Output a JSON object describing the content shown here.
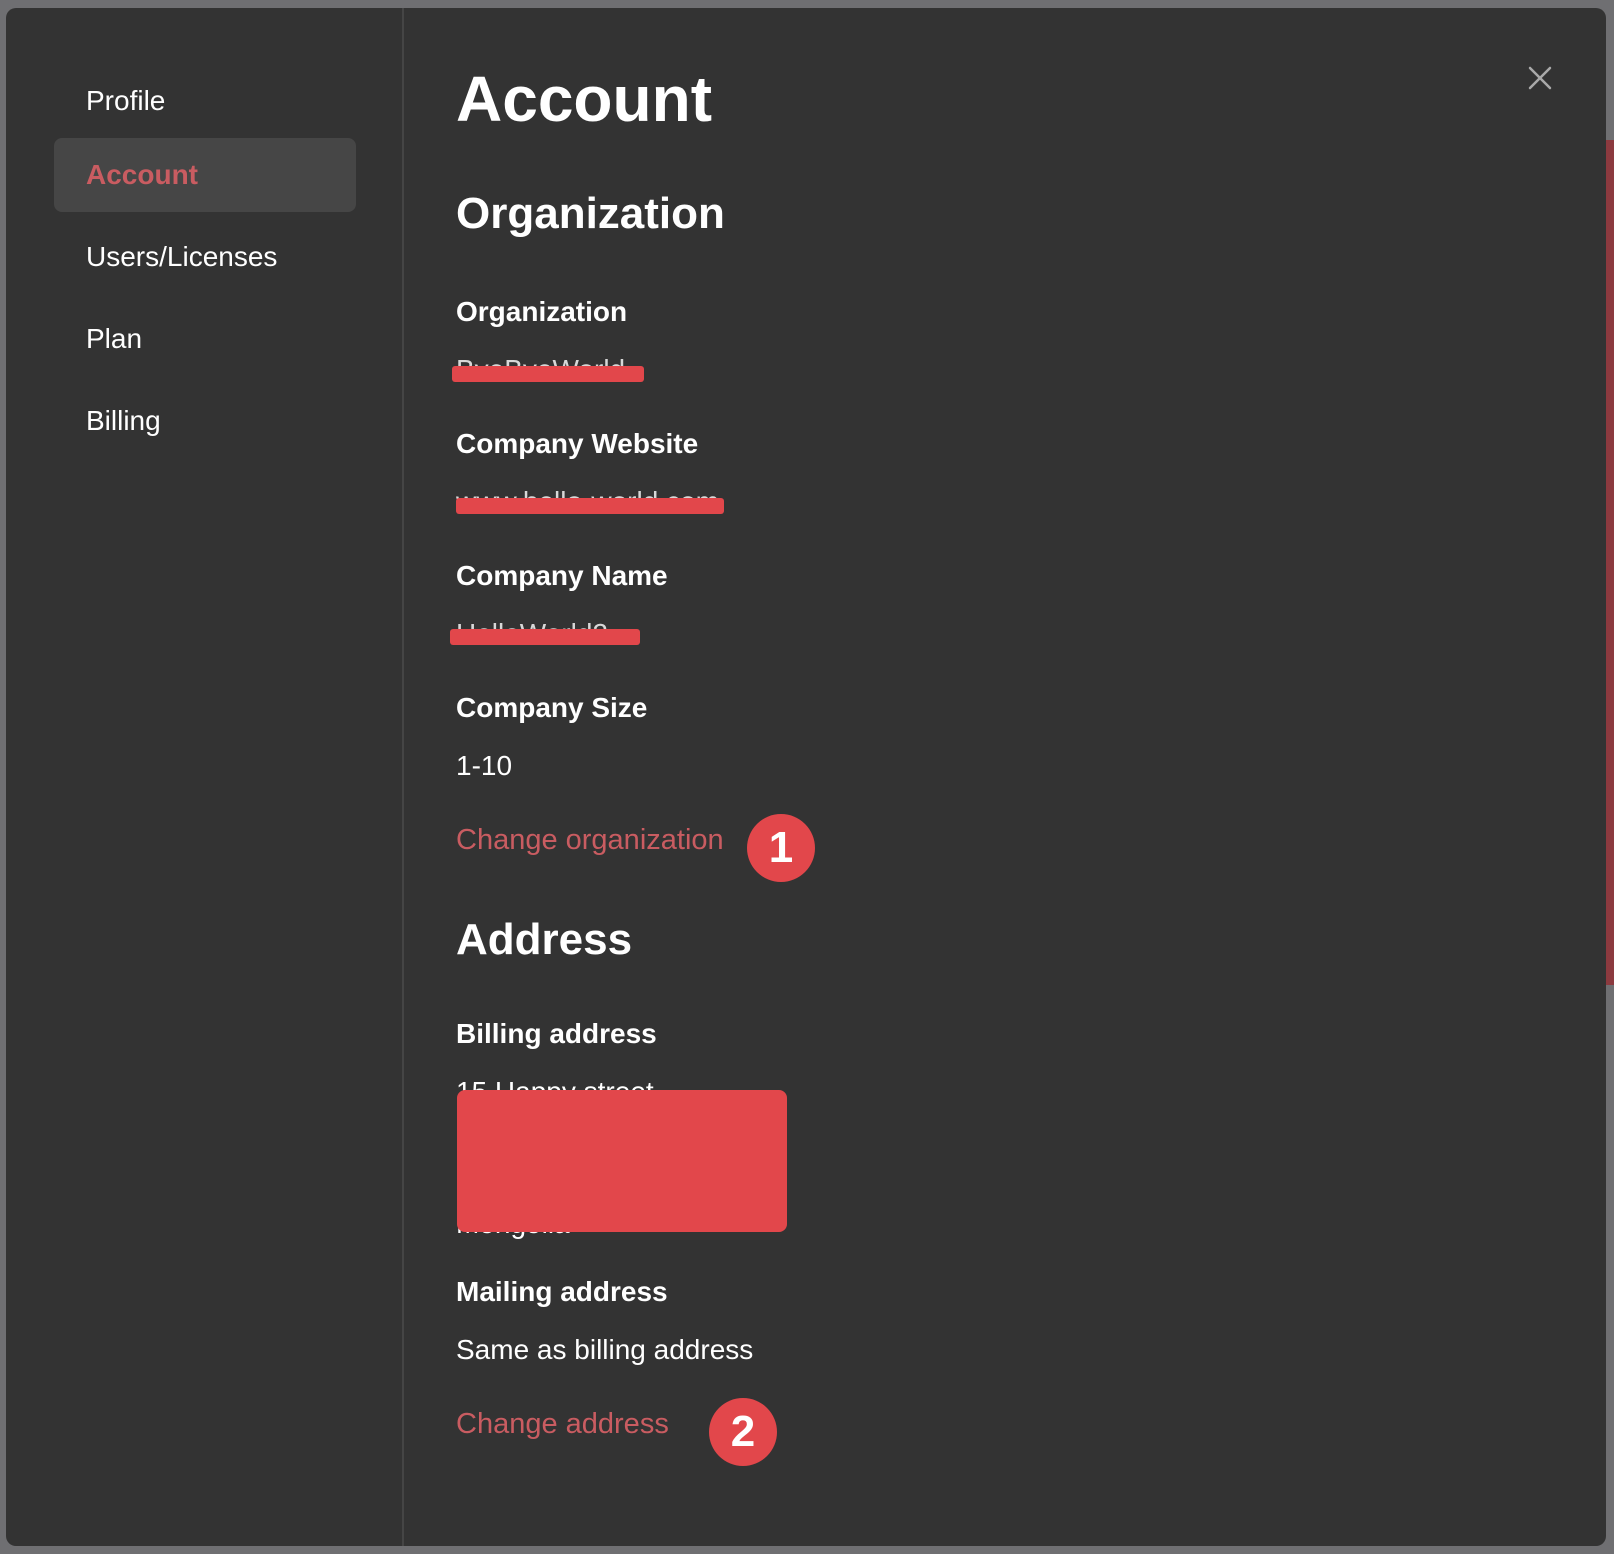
{
  "sidebar": {
    "items": [
      {
        "label": "Profile",
        "active": false
      },
      {
        "label": "Account",
        "active": true
      },
      {
        "label": "Users/Licenses",
        "active": false
      },
      {
        "label": "Plan",
        "active": false
      },
      {
        "label": "Billing",
        "active": false
      }
    ]
  },
  "header": {
    "title": "Account",
    "close_icon": "close-icon"
  },
  "organization": {
    "section_title": "Organization",
    "fields": {
      "organization": {
        "label": "Organization",
        "value": "ByeByeWorld"
      },
      "website": {
        "label": "Company Website",
        "value": "www.hello-world.com"
      },
      "name": {
        "label": "Company Name",
        "value": "HelloWorld2"
      },
      "size": {
        "label": "Company Size",
        "value": "1-10"
      }
    },
    "change_link": "Change organization",
    "annotation": "1"
  },
  "address": {
    "section_title": "Address",
    "billing_label": "Billing address",
    "billing_lines": [
      "15 Happy street",
      "Mongolia"
    ],
    "mailing_label": "Mailing address",
    "mailing_value": "Same as billing address",
    "change_link": "Change address",
    "annotation": "2"
  },
  "colors": {
    "accent": "#c95c61",
    "redaction": "#e2474b",
    "panel": "#333333"
  }
}
